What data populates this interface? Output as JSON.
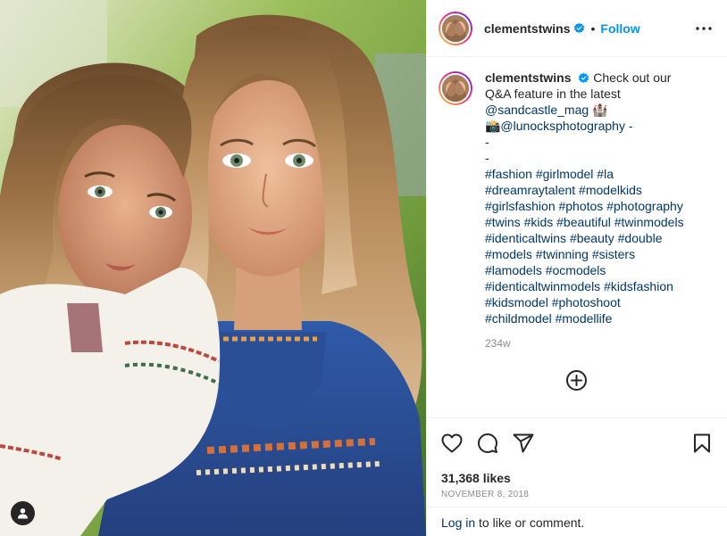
{
  "post": {
    "username": "clementstwins",
    "follow_label": "Follow",
    "separator": "•",
    "more_label": "•••"
  },
  "caption": {
    "username": "clementstwins",
    "lines": [
      "Check out our",
      "Q&A feature in the latest",
      "@sandcastle_mag 🏰",
      "📸@lunocksphotography -",
      "-",
      "-",
      "#fashion #girlmodel #la",
      "#dreamraytalent #modelkids",
      "#girlsfashion #photos #photography",
      "#twins #kids #beautiful #twinmodels",
      "#identicaltwins #beauty #double",
      "#models #twinning #sisters",
      "#lamodels #ocmodels",
      "#identicaltwinmodels #kidsfashion",
      "#kidsmodel #photoshoot",
      "#childmodel #modellife"
    ],
    "time_ago": "234w"
  },
  "engagement": {
    "likes": "31,368 likes",
    "date": "NOVEMBER 8, 2018"
  },
  "login_bar": {
    "link": "Log in",
    "text": " to like or comment."
  },
  "icons": {
    "verified": "verified-badge-icon",
    "more": "more-options-icon",
    "load_more": "plus-circle-icon",
    "like": "heart-icon",
    "comment": "comment-icon",
    "share": "paper-plane-icon",
    "save": "bookmark-icon",
    "tags": "user-tag-icon"
  },
  "colors": {
    "link": "#00376b",
    "follow": "#0095f6",
    "verified": "#0095f6",
    "muted": "#8e8e8e",
    "text": "#262626"
  }
}
